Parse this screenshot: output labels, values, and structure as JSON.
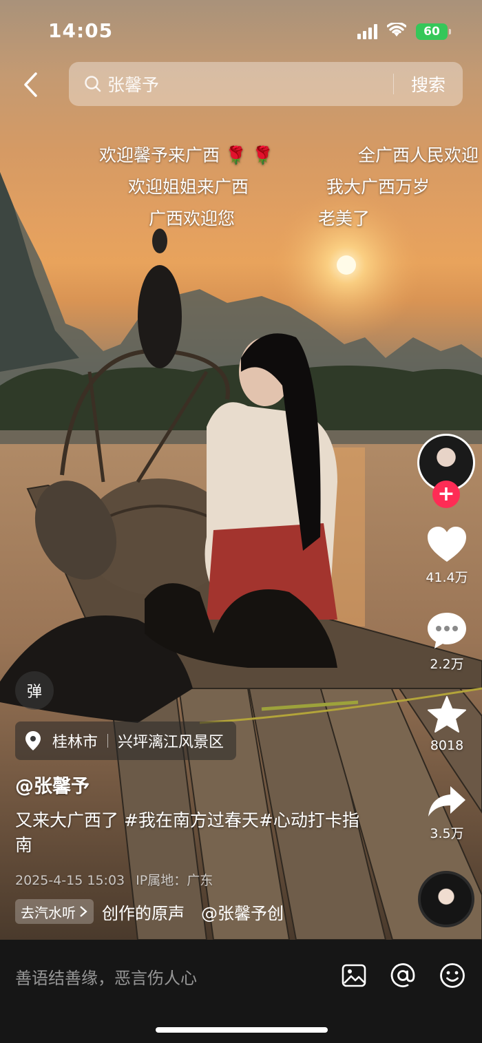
{
  "status_bar": {
    "time": "14:05",
    "battery": "60"
  },
  "search": {
    "query": "张馨予",
    "button": "搜索"
  },
  "danmaku": [
    "欢迎馨予来广西 🌹 🌹",
    "全广西人民欢迎",
    "欢迎姐姐来广西",
    "我大广西万岁",
    "广西欢迎您",
    "老美了"
  ],
  "actions": {
    "follow_symbol": "+",
    "likes": "41.4万",
    "comments": "2.2万",
    "favorites": "8018",
    "shares": "3.5万"
  },
  "danmu_toggle": "弹",
  "location": {
    "city": "桂林市",
    "place": "兴坪漓江风景区"
  },
  "post": {
    "author": "@张馨予",
    "description": "又来大广西了 #我在南方过春天#心动打卡指南",
    "date": "2025-4-15 15:03",
    "ip": "IP属地：广东"
  },
  "music": {
    "qishui_label": "去汽水听",
    "text": "创作的原声　@张馨予创"
  },
  "comment_bar": {
    "placeholder": "善语结善缘，恶言伤人心"
  },
  "icons": [
    "back-icon",
    "search-icon",
    "wifi-icon",
    "heart-icon",
    "comment-icon",
    "star-icon",
    "share-icon",
    "location-pin-icon",
    "image-icon",
    "at-icon",
    "emoji-icon"
  ]
}
